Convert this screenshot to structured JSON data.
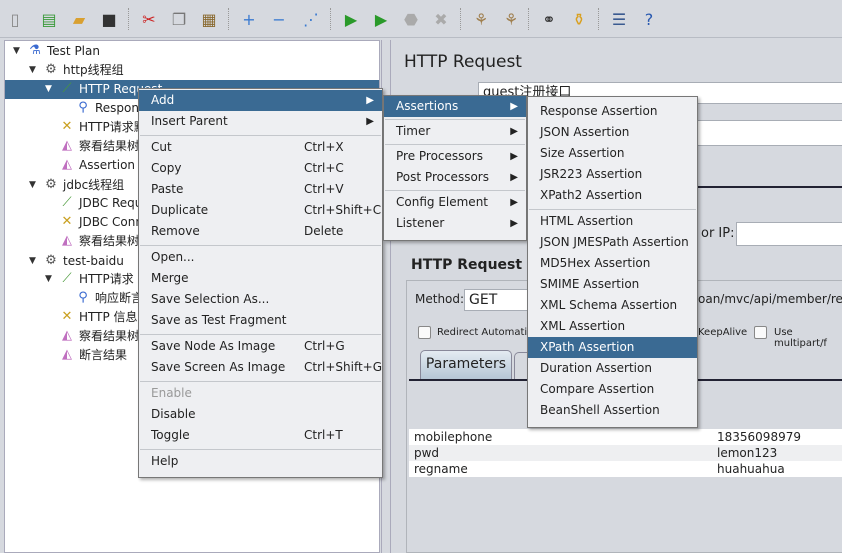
{
  "toolbar": {
    "buttons": [
      {
        "icon": "new-file-icon",
        "glyph": "▯",
        "color": "#888"
      },
      {
        "icon": "templates-icon",
        "glyph": "▤",
        "color": "#3a9a3a"
      },
      {
        "icon": "open-folder-icon",
        "glyph": "▰",
        "color": "#d9a030"
      },
      {
        "icon": "save-icon",
        "glyph": "■",
        "color": "#333"
      },
      {
        "icon": "cut-icon",
        "glyph": "✂",
        "color": "#c22"
      },
      {
        "icon": "copy-icon",
        "glyph": "❐",
        "color": "#777"
      },
      {
        "icon": "paste-icon",
        "glyph": "▦",
        "color": "#8a6a30"
      },
      {
        "icon": "expand-icon",
        "glyph": "+",
        "color": "#3a7ad0"
      },
      {
        "icon": "collapse-icon",
        "glyph": "−",
        "color": "#3a7ad0"
      },
      {
        "icon": "toggle-icon",
        "glyph": "⋰",
        "color": "#3a7ad0"
      },
      {
        "icon": "start-icon",
        "glyph": "▶",
        "color": "#2a9a2a"
      },
      {
        "icon": "start-no-pause-icon",
        "glyph": "▶",
        "color": "#2a9a2a"
      },
      {
        "icon": "stop-icon",
        "glyph": "⬣",
        "color": "#aaa"
      },
      {
        "icon": "shutdown-icon",
        "glyph": "✖",
        "color": "#aaa"
      },
      {
        "icon": "clear-icon",
        "glyph": "⚘",
        "color": "#a08050"
      },
      {
        "icon": "clear-all-icon",
        "glyph": "⚘",
        "color": "#a08050"
      },
      {
        "icon": "search-binoculars-icon",
        "glyph": "⚭",
        "color": "#333"
      },
      {
        "icon": "reset-search-broom-icon",
        "glyph": "⚱",
        "color": "#d9a020"
      },
      {
        "icon": "function-helper-icon",
        "glyph": "☰",
        "color": "#3a5a90"
      },
      {
        "icon": "help-icon",
        "glyph": "?",
        "color": "#2a5ab0"
      }
    ]
  },
  "tree": [
    {
      "label": "Test Plan",
      "level": 0,
      "arrow": "▼",
      "icon": "test-plan-flask-icon",
      "glyph": "⚗",
      "color": "#3a6ad0"
    },
    {
      "label": "http线程组",
      "level": 1,
      "arrow": "▼",
      "icon": "thread-group-gear-icon",
      "glyph": "⚙",
      "color": "#555"
    },
    {
      "label": "HTTP Request",
      "level": 2,
      "arrow": "▼",
      "icon": "sampler-pipette-icon",
      "glyph": "⟋",
      "color": "#4a9a3a",
      "selected": true
    },
    {
      "label": "Respon",
      "level": 3,
      "icon": "assertion-magnifier-icon",
      "glyph": "⚲",
      "color": "#3a6ad0"
    },
    {
      "label": "HTTP请求默",
      "level": 2,
      "icon": "config-tools-icon",
      "glyph": "✕",
      "color": "#c9a020"
    },
    {
      "label": "察看结果树",
      "level": 2,
      "icon": "listener-graph-icon",
      "glyph": "◭",
      "color": "#c070c0"
    },
    {
      "label": "Assertion R",
      "level": 2,
      "icon": "listener-graph-icon",
      "glyph": "◭",
      "color": "#c070c0"
    },
    {
      "label": "jdbc线程组",
      "level": 1,
      "arrow": "▼",
      "icon": "thread-group-gear-icon",
      "glyph": "⚙",
      "color": "#555"
    },
    {
      "label": "JDBC Requ",
      "level": 2,
      "icon": "sampler-pipette-icon",
      "glyph": "⟋",
      "color": "#4a9a3a"
    },
    {
      "label": "JDBC Conn",
      "level": 2,
      "icon": "config-tools-icon",
      "glyph": "✕",
      "color": "#c9a020"
    },
    {
      "label": "察看结果树",
      "level": 2,
      "icon": "listener-graph-icon",
      "glyph": "◭",
      "color": "#c070c0"
    },
    {
      "label": "test-baidu",
      "level": 1,
      "arrow": "▼",
      "icon": "thread-group-gear-icon",
      "glyph": "⚙",
      "color": "#555"
    },
    {
      "label": "HTTP请求",
      "level": 2,
      "arrow": "▼",
      "icon": "sampler-pipette-icon",
      "glyph": "⟋",
      "color": "#4a9a3a"
    },
    {
      "label": "响应断言",
      "level": 3,
      "icon": "assertion-magnifier-icon",
      "glyph": "⚲",
      "color": "#3a6ad0"
    },
    {
      "label": "HTTP 信息头",
      "level": 2,
      "icon": "config-tools-icon",
      "glyph": "✕",
      "color": "#c9a020"
    },
    {
      "label": "察看结果树",
      "level": 2,
      "icon": "listener-graph-icon",
      "glyph": "◭",
      "color": "#c070c0"
    },
    {
      "label": "断言结果",
      "level": 2,
      "icon": "listener-graph-icon",
      "glyph": "◭",
      "color": "#c070c0"
    }
  ],
  "right": {
    "title": "HTTP Request",
    "name_value": "quest注册接口",
    "server_label": "or IP:",
    "section_title": "HTTP Request",
    "method_label": "Method:",
    "method_value": "GET",
    "path_value": "oan/mvc/api/member/regis",
    "redirect_label": "Redirect Automatic",
    "keepalive_label": "KeepAlive",
    "multipart_label": "Use multipart/f",
    "tab_parameters": "Parameters",
    "params": [
      {
        "name": "mobilephone",
        "value": "18356098979"
      },
      {
        "name": "pwd",
        "value": "lemon123"
      },
      {
        "name": "regname",
        "value": "huahuahua"
      }
    ]
  },
  "context_menu": [
    {
      "label": "Add",
      "submenu": true,
      "highlighted": true
    },
    {
      "label": "Insert Parent",
      "submenu": true
    },
    {
      "sep": true
    },
    {
      "label": "Cut",
      "shortcut": "Ctrl+X"
    },
    {
      "label": "Copy",
      "shortcut": "Ctrl+C"
    },
    {
      "label": "Paste",
      "shortcut": "Ctrl+V"
    },
    {
      "label": "Duplicate",
      "shortcut": "Ctrl+Shift+C"
    },
    {
      "label": "Remove",
      "shortcut": "Delete"
    },
    {
      "sep": true
    },
    {
      "label": "Open..."
    },
    {
      "label": "Merge"
    },
    {
      "label": "Save Selection As..."
    },
    {
      "label": "Save as Test Fragment"
    },
    {
      "sep": true
    },
    {
      "label": "Save Node As Image",
      "shortcut": "Ctrl+G"
    },
    {
      "label": "Save Screen As Image",
      "shortcut": "Ctrl+Shift+G"
    },
    {
      "sep": true
    },
    {
      "label": "Enable",
      "disabled": true
    },
    {
      "label": "Disable"
    },
    {
      "label": "Toggle",
      "shortcut": "Ctrl+T"
    },
    {
      "sep": true
    },
    {
      "label": "Help"
    }
  ],
  "add_menu": [
    {
      "label": "Assertions",
      "submenu": true,
      "highlighted": true
    },
    {
      "sep": true
    },
    {
      "label": "Timer",
      "submenu": true
    },
    {
      "sep": true
    },
    {
      "label": "Pre Processors",
      "submenu": true
    },
    {
      "label": "Post Processors",
      "submenu": true
    },
    {
      "sep": true
    },
    {
      "label": "Config Element",
      "submenu": true
    },
    {
      "label": "Listener",
      "submenu": true
    }
  ],
  "assertions_menu": [
    {
      "label": "Response Assertion"
    },
    {
      "label": "JSON Assertion"
    },
    {
      "label": "Size Assertion"
    },
    {
      "label": "JSR223 Assertion"
    },
    {
      "label": "XPath2 Assertion"
    },
    {
      "sep": true
    },
    {
      "label": "HTML Assertion"
    },
    {
      "label": "JSON JMESPath Assertion"
    },
    {
      "label": "MD5Hex Assertion"
    },
    {
      "label": "SMIME Assertion"
    },
    {
      "label": "XML Schema Assertion"
    },
    {
      "label": "XML Assertion"
    },
    {
      "label": "XPath Assertion",
      "highlighted": true
    },
    {
      "label": "Duration Assertion"
    },
    {
      "label": "Compare Assertion"
    },
    {
      "label": "BeanShell Assertion"
    }
  ]
}
